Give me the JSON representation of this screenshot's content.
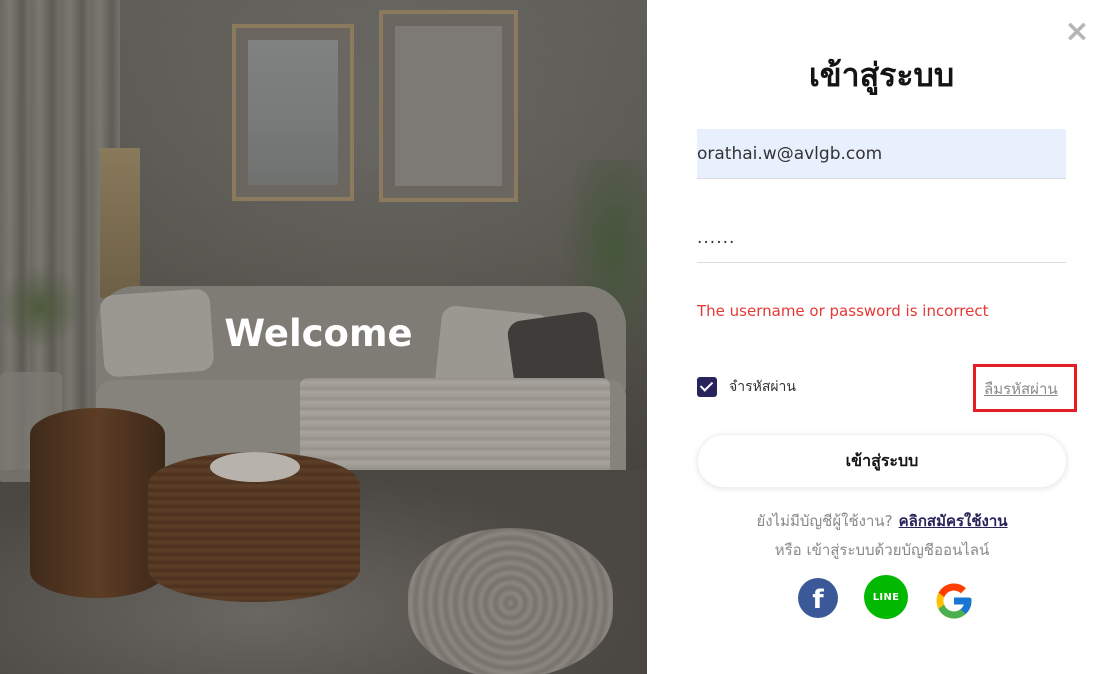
{
  "hero": {
    "welcome_text": "Welcome"
  },
  "login_modal": {
    "close_label": "×",
    "title": "เข้าสู่ระบบ",
    "email_value": "orathai.w@avlgb.com",
    "password_value": "......",
    "error_message": "The username or password is incorrect",
    "remember_label": "จำรหัสผ่าน",
    "remember_checked": true,
    "forgot_label": "ลืมรหัสผ่าน",
    "login_button_label": "เข้าสู่ระบบ",
    "no_account_text": "ยังไม่มีบัญชีผู้ใช้งาน?",
    "signup_link_label": "คลิกสมัครใช้งาน",
    "social_prompt": "หรือ เข้าสู่ระบบด้วยบัญชีออนไลน์",
    "social": {
      "facebook_label": "f",
      "line_label": "LINE"
    }
  },
  "colors": {
    "brand_navy": "#26245a",
    "error_red": "#e53935",
    "highlight_red": "#e81c24",
    "facebook_blue": "#3b5998",
    "line_green": "#00b900",
    "autofill_blue": "#e8f0fe"
  },
  "icons": {
    "close": "close-icon",
    "checkbox": "check-icon",
    "facebook": "facebook-icon",
    "line": "line-icon",
    "google": "google-icon"
  }
}
